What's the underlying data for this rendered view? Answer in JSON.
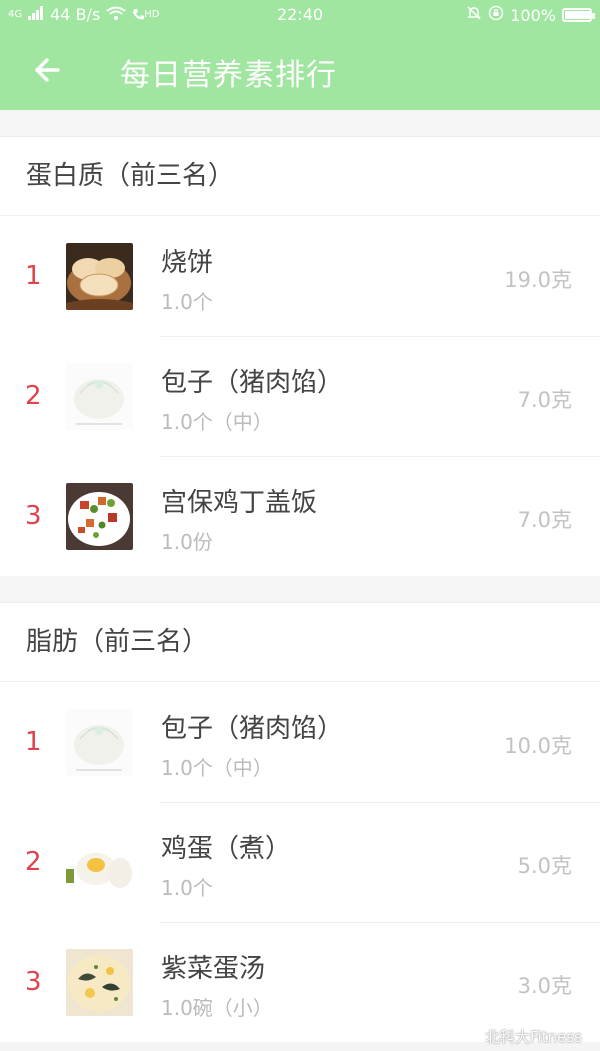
{
  "status_bar": {
    "network": "4G",
    "speed": "44 B/s",
    "hd": "HD",
    "time": "22:40",
    "battery": "100%",
    "battery_level": 1.0
  },
  "app_bar": {
    "title": "每日营养素排行",
    "back_icon": "arrow-left-icon"
  },
  "sections": [
    {
      "title": "蛋白质（前三名）",
      "items": [
        {
          "rank": "1",
          "name": "烧饼",
          "serving": "1.0个",
          "amount": "19.0克",
          "image": "flatbread"
        },
        {
          "rank": "2",
          "name": "包子（猪肉馅）",
          "serving": "1.0个（中）",
          "amount": "7.0克",
          "image": "bun"
        },
        {
          "rank": "3",
          "name": "宫保鸡丁盖饭",
          "serving": "1.0份",
          "amount": "7.0克",
          "image": "kungpao"
        }
      ]
    },
    {
      "title": "脂肪（前三名）",
      "items": [
        {
          "rank": "1",
          "name": "包子（猪肉馅）",
          "serving": "1.0个（中）",
          "amount": "10.0克",
          "image": "bun"
        },
        {
          "rank": "2",
          "name": "鸡蛋（煮）",
          "serving": "1.0个",
          "amount": "5.0克",
          "image": "egg"
        },
        {
          "rank": "3",
          "name": "紫菜蛋汤",
          "serving": "1.0碗（小）",
          "amount": "3.0克",
          "image": "soup"
        }
      ]
    }
  ],
  "watermark": "北科大Fitness"
}
